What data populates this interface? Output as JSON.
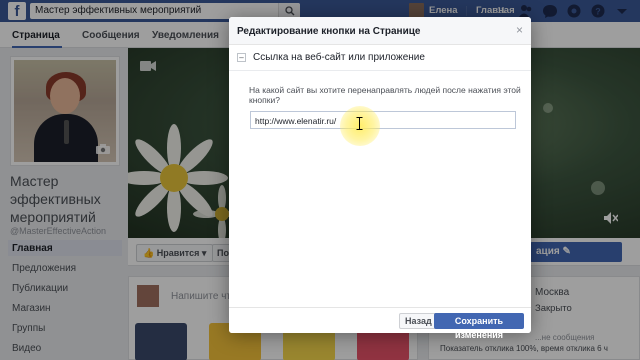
{
  "topbar": {
    "logo": "f",
    "search_value": "Мастер эффективных мероприятий",
    "user_name": "Елена",
    "home_label": "Главная",
    "home_count": "11"
  },
  "tabs": [
    {
      "label": "Страница"
    },
    {
      "label": "Сообщения"
    },
    {
      "label": "Уведомления"
    }
  ],
  "page": {
    "title": "Мастер эффективных мероприятий",
    "handle": "@MasterEffectiveAction"
  },
  "side_nav": [
    {
      "label": "Главная"
    },
    {
      "label": "Предложения"
    },
    {
      "label": "Публикации"
    },
    {
      "label": "Магазин"
    },
    {
      "label": "Группы"
    },
    {
      "label": "Видео"
    }
  ],
  "action_bar": {
    "like_label": "Нравится",
    "share_label": "По",
    "cta_label": "ация"
  },
  "composer": {
    "placeholder": "Напишите что-"
  },
  "right_col": {
    "city": "Москва",
    "status": "Закрыто",
    "status_note": "...не сообщения",
    "response": "Показатель отклика 100%, время отклика 6 ч"
  },
  "dialog": {
    "title": "Редактирование кнопки на Странице",
    "close_glyph": "×",
    "option_label": "Ссылка на веб-сайт или приложение",
    "option_toggle": "–",
    "question": "На какой сайт вы хотите перенаправлять людей после нажатия этой кнопки?",
    "url_value": "http://www.elenatir.ru/",
    "back_label": "Назад",
    "save_label": "Сохранить изменения"
  },
  "colors": {
    "brand": "#3b5998",
    "primary_button": "#4267b2",
    "cursor_highlight": "#ffec5a"
  }
}
